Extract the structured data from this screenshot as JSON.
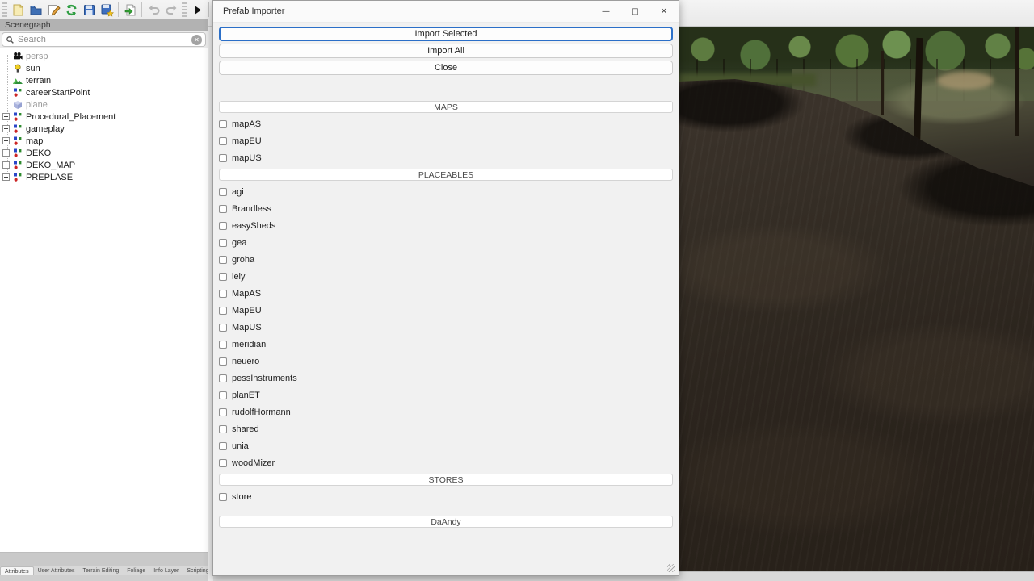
{
  "colors": {
    "accent_focus": "#2b6fc8",
    "panel_header": "#b2b2b2",
    "dialog_bg": "#f1f1f1",
    "soil_dark": "#2b2520",
    "tree_green": "#4f6d38"
  },
  "toolbar": {
    "icons": [
      "new-scene",
      "open-file",
      "edit-document",
      "reload",
      "save",
      "save-as",
      "import",
      "undo",
      "redo",
      "play",
      "toggle-visibility",
      "search"
    ]
  },
  "scenegraph": {
    "title": "Scenegraph",
    "search_placeholder": "Search",
    "nodes": [
      {
        "label": "persp",
        "icon": "camera",
        "muted": true,
        "expandable": false
      },
      {
        "label": "sun",
        "icon": "light",
        "muted": false,
        "expandable": false
      },
      {
        "label": "terrain",
        "icon": "terrain",
        "muted": false,
        "expandable": false
      },
      {
        "label": "careerStartPoint",
        "icon": "transform",
        "muted": false,
        "expandable": false
      },
      {
        "label": "plane",
        "icon": "cube",
        "muted": true,
        "expandable": false
      },
      {
        "label": "Procedural_Placement",
        "icon": "transform",
        "muted": false,
        "expandable": true
      },
      {
        "label": "gameplay",
        "icon": "transform",
        "muted": false,
        "expandable": true
      },
      {
        "label": "map",
        "icon": "transform",
        "muted": false,
        "expandable": true
      },
      {
        "label": "DEKO",
        "icon": "transform",
        "muted": false,
        "expandable": true
      },
      {
        "label": "DEKO_MAP",
        "icon": "transform",
        "muted": false,
        "expandable": true
      },
      {
        "label": "PREPLASE",
        "icon": "transform",
        "muted": false,
        "expandable": true
      }
    ]
  },
  "bottom_tabs": {
    "tabs": [
      "Attributes",
      "User Attributes",
      "Terrain Editing",
      "Foliage",
      "Info Layer",
      "Scripting"
    ],
    "active_index": 0
  },
  "dialog": {
    "title": "Prefab Importer",
    "controls": {
      "minimize": "—",
      "maximize": "□",
      "close": "✕"
    },
    "buttons": [
      "Import Selected",
      "Import All",
      "Close"
    ],
    "sections": [
      {
        "header": "MAPS",
        "items": [
          "mapAS",
          "mapEU",
          "mapUS"
        ]
      },
      {
        "header": "PLACEABLES",
        "items": [
          "agi",
          "Brandless",
          "easySheds",
          "gea",
          "groha",
          "lely",
          "MapAS",
          "MapEU",
          "MapUS",
          "meridian",
          "neuero",
          "pessInstruments",
          "planET",
          "rudolfHormann",
          "shared",
          "unia",
          "woodMizer"
        ]
      },
      {
        "header": "STORES",
        "items": [
          "store"
        ]
      }
    ],
    "footer_bar": "DaAndy"
  }
}
